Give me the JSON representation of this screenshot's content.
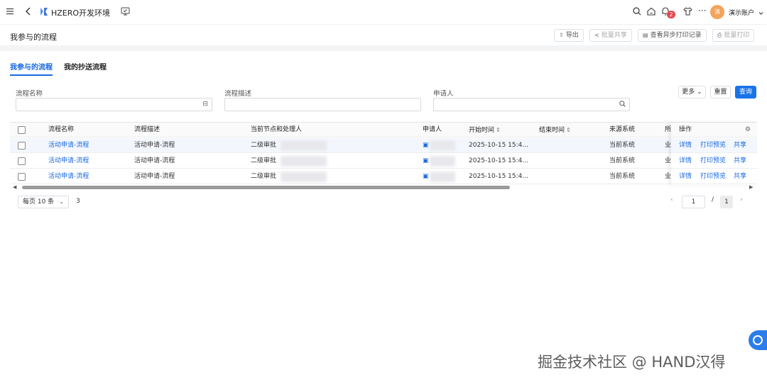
{
  "app": {
    "title": "HZERO开发环境",
    "badge_count": "2",
    "avatar_text": "演",
    "account_name": "演示账户"
  },
  "icons": [
    "menu-icon",
    "back-icon",
    "brand-logo-icon",
    "monitor-icon",
    "search-icon",
    "home-icon",
    "bell-icon",
    "shirt-icon",
    "more-icon",
    "chevron-down-icon",
    "export-icon",
    "share-icon",
    "printer-icon",
    "search-icon",
    "settings-icon",
    "chat-icon"
  ],
  "page": {
    "title": "我参与的流程"
  },
  "toolbar": {
    "export_label": "导出",
    "batch_share_label": "批量共享",
    "async_print_label": "查看异步打印记录",
    "batch_print_label": "批量打印"
  },
  "tabs": [
    {
      "label": "我参与的流程",
      "active": true
    },
    {
      "label": "我的抄送流程",
      "active": false
    }
  ],
  "filters": {
    "flow_name_label": "流程名称",
    "flow_desc_label": "流程描述",
    "applicant_label": "申请人",
    "more_label": "更多",
    "reset_label": "重置",
    "query_label": "查询"
  },
  "table": {
    "columns": [
      "流程名称",
      "流程描述",
      "当前节点和处理人",
      "申请人",
      "开始时间",
      "结束时间",
      "来源系统",
      "所",
      "操作"
    ],
    "rows": [
      {
        "name": "活动申请-流程",
        "desc": "活动申请-流程",
        "node": "二级审批",
        "start": "2025-10-15 15:4...",
        "end": "",
        "source": "当前系统",
        "partial": "业",
        "op_detail": "详情",
        "op_print": "打印预览",
        "op_share": "共享"
      },
      {
        "name": "活动申请-流程",
        "desc": "活动申请-流程",
        "node": "二级审批",
        "start": "2025-10-15 15:4...",
        "end": "",
        "source": "当前系统",
        "partial": "业",
        "op_detail": "详情",
        "op_print": "打印预览",
        "op_share": "共享"
      },
      {
        "name": "活动申请-流程",
        "desc": "活动申请-流程",
        "node": "二级审批",
        "start": "2025-10-15 15:4...",
        "end": "",
        "source": "当前系统",
        "partial": "业",
        "op_detail": "详情",
        "op_print": "打印预览",
        "op_share": "共享"
      }
    ]
  },
  "pagination": {
    "page_size_label": "每页 10 条",
    "total": "3",
    "current_page": "1",
    "separator": "/",
    "total_pages": "1"
  },
  "watermark": "掘金技术社区 @ HAND汉得"
}
